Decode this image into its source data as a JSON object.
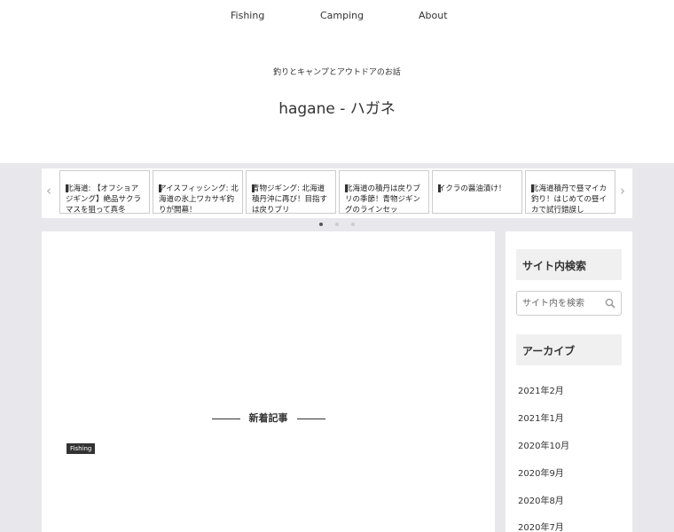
{
  "nav": {
    "items": [
      "Fishing",
      "Camping",
      "About"
    ]
  },
  "header": {
    "tagline": "釣りとキャンプとアウトドアのお話",
    "title": "hagane - ハガネ"
  },
  "carousel": {
    "prev_glyph": "‹",
    "next_glyph": "›",
    "cards": [
      "北海道: 【オフショアジギング】絶品サクラマスを狙って真冬",
      "アイスフィッシング: 北海道の氷上ワカサギ釣りが開幕！",
      "青物ジギング: 北海道積丹沖に再び！目指すは戻りブリ",
      "北海道の積丹は戻りブリの季節！青物ジギングのラインセッ",
      "イクラの醤油漬け！",
      "北海道積丹で昼マイカ釣り！はじめての昼イカで試行錯誤し"
    ],
    "active_dot": 0
  },
  "main": {
    "section_heading": "新着記事",
    "category_badge": "Fishing"
  },
  "sidebar": {
    "search_heading": "サイト内検索",
    "search_placeholder": "サイト内を検索",
    "archive_heading": "アーカイブ",
    "archives": [
      "2021年2月",
      "2021年1月",
      "2020年10月",
      "2020年9月",
      "2020年8月",
      "2020年7月"
    ]
  }
}
